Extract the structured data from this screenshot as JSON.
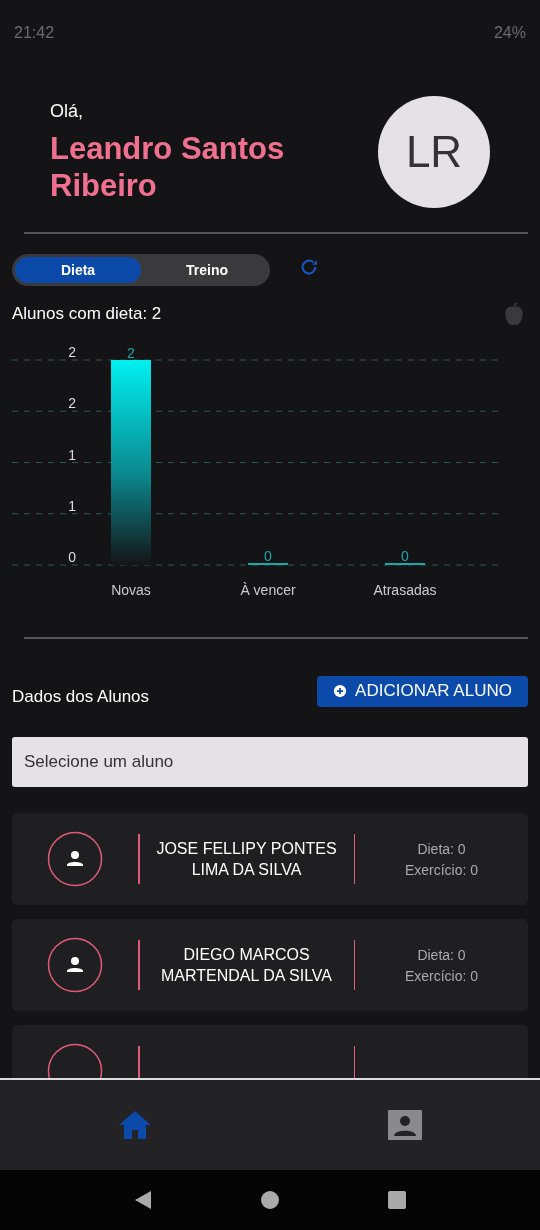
{
  "status_bar": {
    "time": "21:42",
    "battery": "24%"
  },
  "greeting": "Olá,",
  "user_name": "Leandro Santos Ribeiro",
  "avatar_initials": "LR",
  "tabs": [
    {
      "label": "Dieta",
      "selected": true
    },
    {
      "label": "Treino",
      "selected": false
    }
  ],
  "summary": "Alunos com dieta: 2",
  "chart": {
    "chart_data": {
      "type": "bar",
      "categories": [
        "Novas",
        "À vencer",
        "Atrasadas"
      ],
      "values": [
        2,
        0,
        0
      ],
      "ylim": [
        0,
        2
      ],
      "yticks": [
        {
          "value": 0,
          "label": "0"
        },
        {
          "value": 0.5,
          "label": "1"
        },
        {
          "value": 1,
          "label": "1"
        },
        {
          "value": 1.5,
          "label": "2"
        },
        {
          "value": 2,
          "label": "2"
        }
      ],
      "data_labels": true,
      "grid": true
    }
  },
  "students_section": {
    "title": "Dados dos Alunos",
    "add_button": "ADICIONAR ALUNO",
    "select": {
      "placeholder": "Selecione um aluno"
    }
  },
  "students": [
    {
      "name": "JOSE FELLIPY PONTES LIMA DA SILVA",
      "diet": "Dieta: 0",
      "exercise": "Exercício: 0"
    },
    {
      "name": "DIEGO MARCOS MARTENDAL DA SILVA",
      "diet": "Dieta: 0",
      "exercise": "Exercício: 0"
    },
    {
      "kind": "partial"
    }
  ],
  "bottom_nav": [
    {
      "kind": "home",
      "selected": true
    },
    {
      "kind": "profile",
      "selected": false
    }
  ]
}
